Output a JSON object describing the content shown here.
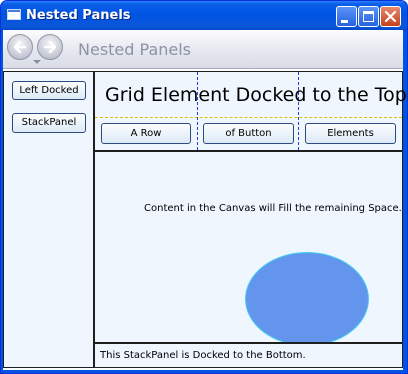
{
  "window": {
    "title": "Nested Panels"
  },
  "navbar": {
    "title": "Nested Panels",
    "back_icon": "back-arrow-icon",
    "forward_icon": "forward-arrow-icon"
  },
  "left_panel": {
    "buttons": [
      {
        "label": "Left Docked"
      },
      {
        "label": "StackPanel"
      }
    ]
  },
  "grid": {
    "title": "Grid Element Docked to the Top.",
    "buttons": [
      {
        "label": "A Row"
      },
      {
        "label": "of Button"
      },
      {
        "label": "Elements"
      }
    ]
  },
  "canvas": {
    "text": "Content in the Canvas will Fill the remaining Space.",
    "ellipse_color": "#6495ED",
    "ellipse_stroke": "#3FD0F0"
  },
  "bottom_panel": {
    "text": "This StackPanel is Docked to the Bottom."
  },
  "colors": {
    "titlebar": "#0054E3",
    "panel_bg": "#F0F6FE",
    "grid_lines_vertical": "#1F3FD6",
    "grid_lines_horizontal": "#E0C000"
  }
}
